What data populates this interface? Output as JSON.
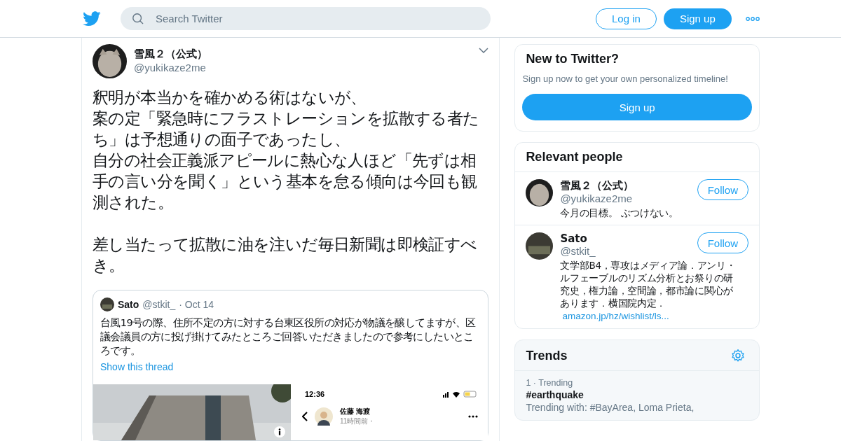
{
  "header": {
    "search": {
      "placeholder": "Search Twitter"
    },
    "login": "Log in",
    "signup": "Sign up"
  },
  "tweet": {
    "name": "雪風２（公式）",
    "handle": "@yukikaze2me",
    "paragraphs": [
      [
        "釈明が本当かを確かめる術はないが、",
        "案の定「緊急時にフラストレーションを拡散する者たち」は予想通りの面子であったし、",
        "自分の社会正義派アピールに熱心な人ほど「先ずは相手の言い分を聞く」という基本を怠る傾向は今回も観測された。"
      ],
      [
        "差し当たって拡散に油を注いだ毎日新聞は即検証すべき。"
      ]
    ],
    "quote": {
      "name": "Sato",
      "handle": "@stkit_",
      "date": "· Oct 14",
      "text": "台風19号の際、住所不定の方に対する台東区役所の対応が物議を醸してますが、区議会議員の方に投げ掛けてみたところご回答いただきましたので参考にしたいところです。",
      "link": "Show this thread",
      "phone": {
        "time": "12:36",
        "name": "佐藤 海渡",
        "meta": "11時間前・"
      }
    }
  },
  "signup_card": {
    "title": "New to Twitter?",
    "text": "Sign up now to get your own personalized timeline!",
    "button": "Sign up"
  },
  "relevant": {
    "title": "Relevant people",
    "people": [
      {
        "name": "雪風２（公式）",
        "handle": "@yukikaze2me",
        "bio": "今月の目標。 ぶつけない。",
        "button": "Follow"
      },
      {
        "name": "Sato",
        "handle": "@stkit_",
        "bio": "文学部B4，専攻はメディア論．アンリ・ルフェーブルのリズム分析とお祭りの研究史，権力論，空間論，都市論に関心があります．横国院内定．",
        "link": "amazon.jp/hz/wishlist/ls...",
        "button": "Follow"
      }
    ]
  },
  "trends": {
    "title": "Trends",
    "items": [
      {
        "meta": "1 · Trending",
        "tag": "#earthquake",
        "with": "Trending with: #BayArea, Loma Prieta,"
      }
    ]
  }
}
